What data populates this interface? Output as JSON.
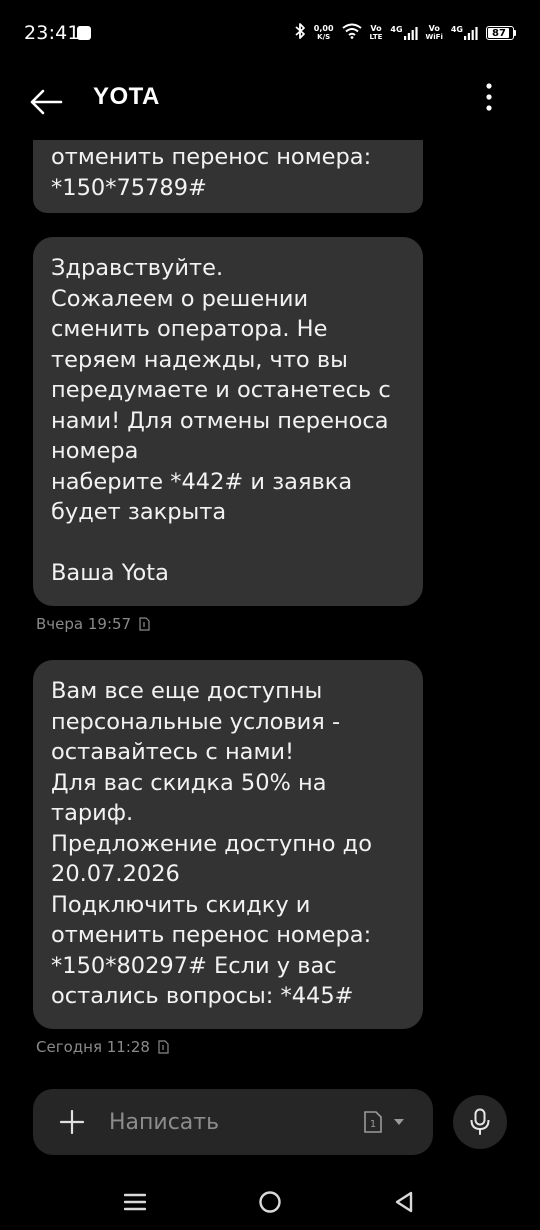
{
  "status_bar": {
    "time": "23:41",
    "speed_value": "0,00",
    "speed_unit": "K/S",
    "vo_lte_top": "Vo",
    "vo_lte_bottom": "LTE",
    "net1": "4G",
    "vo_wifi_top": "Vo",
    "vo_wifi_bottom": "WiFi",
    "net2": "4G",
    "battery": "87"
  },
  "header": {
    "contact_name": "YOTA"
  },
  "messages": [
    {
      "text": "отменить перенос номера:\n*150*75789#"
    },
    {
      "text": "Здравствуйте.\nСожалеем о решении\nсменить оператора. Не\nтеряем надежды, что вы\nпередумаете и останетесь с\nнами! Для отмены переноса\nномера\nнаберите *442# и заявка\nбудет закрыта\n\nВаша Yota",
      "timestamp": "Вчера 19:57"
    },
    {
      "text": "Вам все еще доступны\nперсональные условия -\nоставайтесь с нами!\nДля вас скидка 50% на\nтариф.\nПредложение доступно до\n20.07.2026\nПодключить скидку и\nотменить перенос номера:\n*150*80297# Если у вас\nостались вопросы: *445#",
      "timestamp": "Сегодня 11:28"
    }
  ],
  "compose": {
    "placeholder": "Написать",
    "sim_slot": "1"
  },
  "colors": {
    "background": "#000000",
    "bubble": "#333333",
    "compose": "#262626",
    "timestamp": "#8a8a8a"
  }
}
